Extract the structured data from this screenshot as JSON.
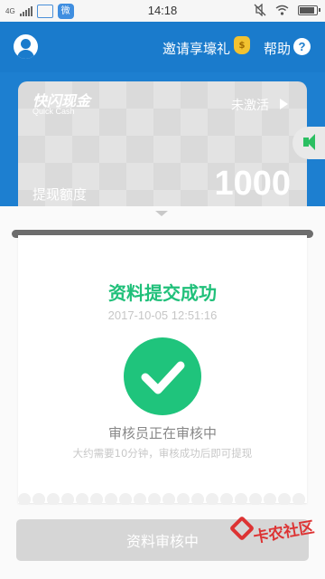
{
  "status_bar": {
    "network": "4G",
    "time": "14:18",
    "app_badge": "微"
  },
  "header": {
    "invite_label": "邀请享壕礼",
    "gift_badge": "$",
    "help_label": "帮助",
    "help_icon_glyph": "?"
  },
  "card": {
    "brand": "快闪现金",
    "brand_sub": "Quick Cash",
    "status_label": "未激活",
    "amount_label": "提现额度",
    "amount": "1000"
  },
  "result": {
    "title": "资料提交成功",
    "timestamp": "2017-10-05 12:51:16",
    "review_title": "审核员正在审核中",
    "review_note": "大约需要10分钟，审核成功后即可提现"
  },
  "footer": {
    "button_label": "资料审核中"
  },
  "watermark": {
    "text": "卡农社区"
  },
  "colors": {
    "primary": "#1a7bcc",
    "success": "#1fc47c",
    "disabled_button": "#d6d6d6",
    "watermark": "#dd3333"
  }
}
